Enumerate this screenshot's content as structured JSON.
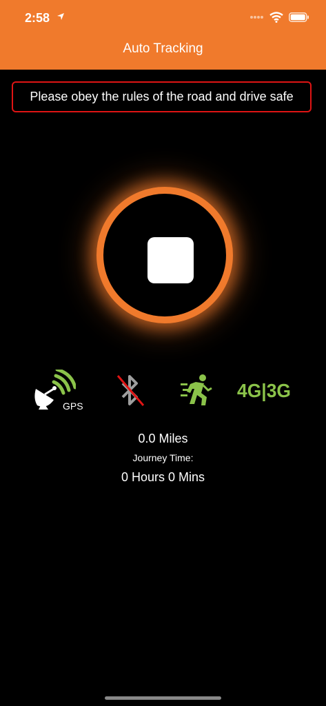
{
  "status_bar": {
    "time": "2:58"
  },
  "header": {
    "title": "Auto Tracking"
  },
  "notice": {
    "text": "Please obey the rules of the road and drive safe"
  },
  "tracking": {
    "control": "stop-button",
    "accent_color": "#F07A2C"
  },
  "indicators": [
    {
      "name": "gps-icon",
      "label": "GPS",
      "color": "#8BC34A"
    },
    {
      "name": "bluetooth-disabled-icon",
      "color": "#9E9E9E"
    },
    {
      "name": "motion-running-icon",
      "color": "#8BC34A"
    },
    {
      "name": "network-4g-3g-icon",
      "label": "4G|3G",
      "color": "#8BC34A"
    }
  ],
  "journey": {
    "distance": "0.0 Miles",
    "time_label": "Journey Time:",
    "duration": "0 Hours 0 Mins"
  }
}
